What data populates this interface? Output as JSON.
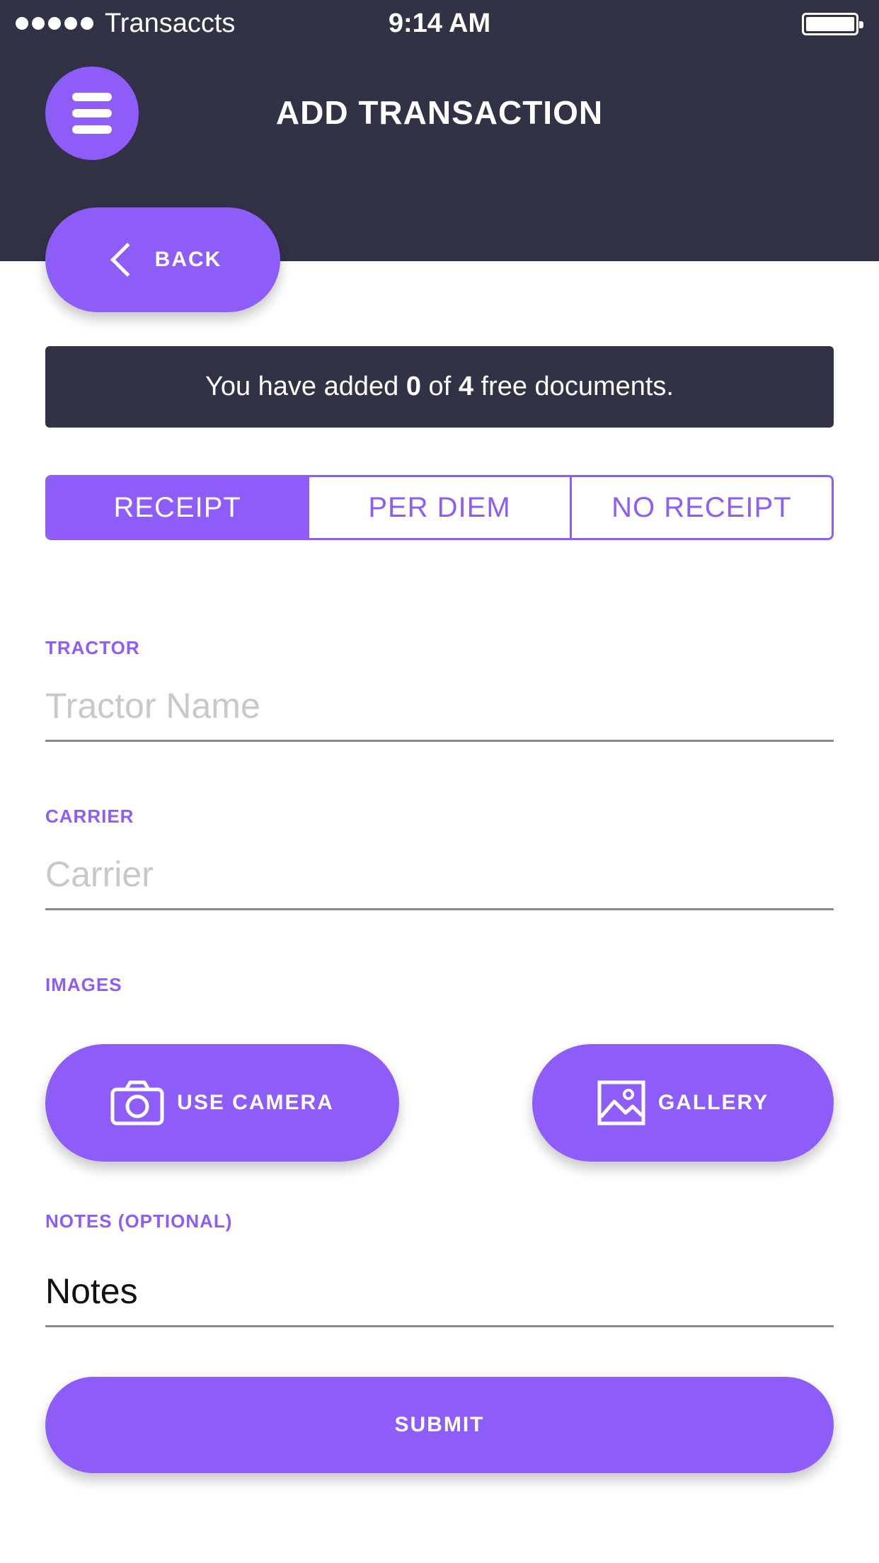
{
  "status_bar": {
    "carrier": "Transaccts",
    "time": "9:14 AM",
    "signal_icon": "signal-dots-icon",
    "battery_icon": "battery-full-icon"
  },
  "header": {
    "menu_icon": "hamburger-menu-icon",
    "title": "ADD TRANSACTION",
    "background_color": "#323246"
  },
  "back_button": {
    "icon": "chevron-left-icon",
    "label": "BACK"
  },
  "notice": {
    "prefix": "You have added ",
    "added_count": "0",
    "middle": " of ",
    "total_count": "4",
    "suffix": " free documents."
  },
  "segments": {
    "items": [
      {
        "label": "RECEIPT",
        "active": true
      },
      {
        "label": "PER DIEM",
        "active": false
      },
      {
        "label": "NO RECEIPT",
        "active": false
      }
    ]
  },
  "form": {
    "tractor": {
      "label": "TRACTOR",
      "placeholder": "Tractor Name",
      "value": ""
    },
    "carrier": {
      "label": "CARRIER",
      "placeholder": "Carrier",
      "value": ""
    },
    "images": {
      "label": "IMAGES",
      "camera_button": {
        "icon": "camera-icon",
        "label": "USE CAMERA"
      },
      "gallery_button": {
        "icon": "image-gallery-icon",
        "label": "GALLERY"
      }
    },
    "notes": {
      "label": "NOTES (OPTIONAL)",
      "value": "Notes"
    }
  },
  "submit_button": {
    "label": "SUBMIT"
  },
  "colors": {
    "accent": "#8d5cf9",
    "dark": "#323246",
    "placeholder": "#c8c8cc"
  }
}
